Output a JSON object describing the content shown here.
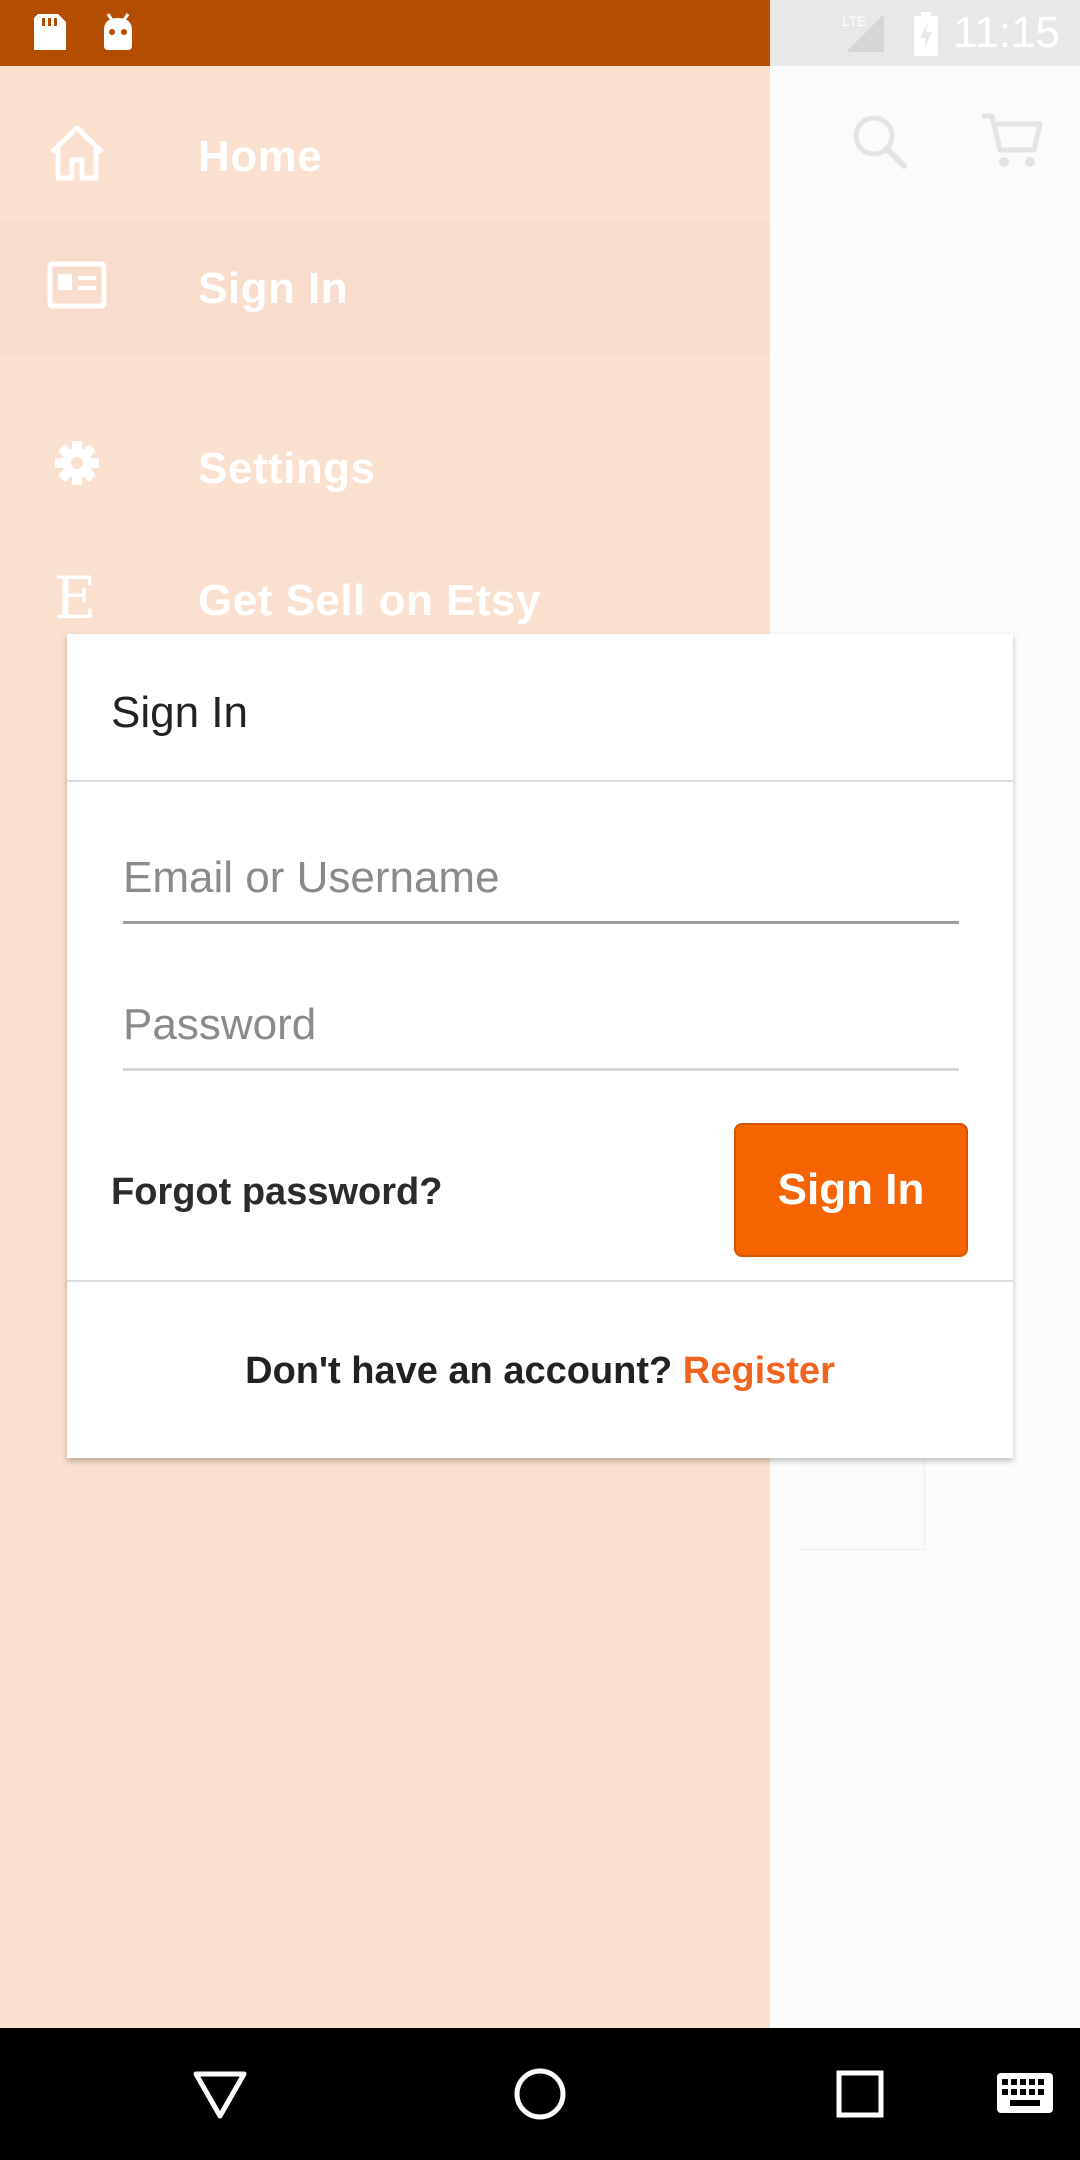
{
  "status_bar": {
    "time": "11:15",
    "left_icons": [
      "sd-card-icon",
      "android-debug-icon"
    ],
    "right_icons": [
      "lte-signal-icon",
      "battery-charging-icon"
    ],
    "network_label": "LTE"
  },
  "drawer": {
    "items": [
      {
        "label": "Home",
        "icon": "home-icon"
      },
      {
        "label": "Sign In",
        "icon": "id-card-icon",
        "active": true
      },
      {
        "label": "Settings",
        "icon": "gear-icon"
      },
      {
        "label": "Get Sell on Etsy",
        "icon": "etsy-e-icon",
        "glyph": "E"
      }
    ]
  },
  "background_app": {
    "toolbar_icons": [
      "search-icon",
      "cart-icon"
    ]
  },
  "dialog": {
    "title": "Sign In",
    "email_placeholder": "Email or Username",
    "password_placeholder": "Password",
    "forgot_password": "Forgot password?",
    "sign_in_button": "Sign In",
    "register_prompt": "Don't have an account?",
    "register_link": "Register"
  },
  "nav_bar": {
    "buttons": [
      "back-icon",
      "home-circle-icon",
      "recents-icon",
      "keyboard-icon"
    ]
  },
  "colors": {
    "status_bar": "#b34d00",
    "drawer_bg": "#fae0ce",
    "accent": "#f56400",
    "register_link": "#f1641e"
  }
}
